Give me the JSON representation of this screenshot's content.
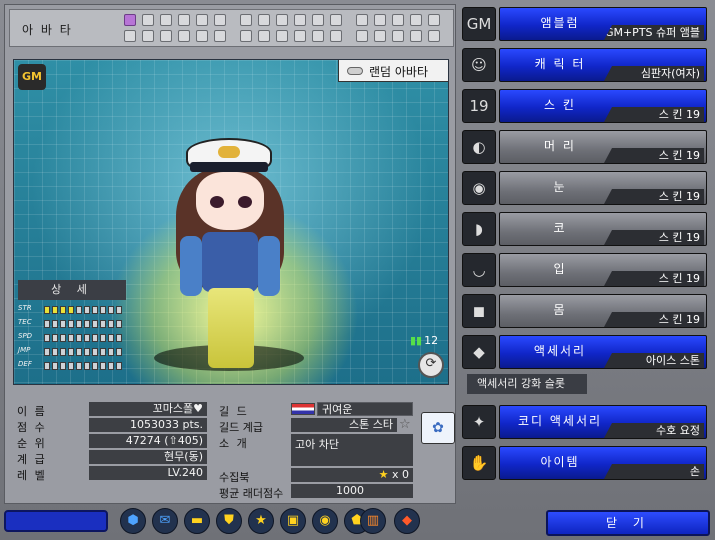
{
  "avatar_header": {
    "title": "아 바 타"
  },
  "viewer": {
    "logo": "GM",
    "random_button": "랜덤 아바타",
    "signal_value": "12",
    "detail_title": "상 세",
    "stats": [
      {
        "name": "STR",
        "level": 4
      },
      {
        "name": "TEC",
        "level": 0
      },
      {
        "name": "SPD",
        "level": 0
      },
      {
        "name": "JMP",
        "level": 0
      },
      {
        "name": "DEF",
        "level": 0
      }
    ]
  },
  "info": {
    "name_label": "이 름",
    "name_value": "꼬마스폴♥",
    "score_label": "점 수",
    "score_value": "1053033 pts.",
    "rank_label": "순 위",
    "rank_value": "47274 (⇧405)",
    "grade_label": "계 급",
    "grade_value": "현무(동)",
    "level_label": "레 벨",
    "level_value": "LV.240",
    "guild_label": "길 드",
    "guild_value": "귀여운",
    "guild_grade_label": "길드 계급",
    "guild_grade_value": "스톤 스타",
    "intro_label": "소 개",
    "intro_value": "고아 차단",
    "collection_label": "수집북",
    "collection_value": "x 0",
    "ladder_label": "평균 래더점수",
    "ladder_value": "1000"
  },
  "right_menu": [
    {
      "label": "앰블럼",
      "value": "GM+PTS 슈퍼 앰블럼",
      "style": "blue",
      "icon": "gm-emblem-icon",
      "glyph": "GM"
    },
    {
      "label": "캐 릭 터",
      "value": "심판자(여자)",
      "style": "blue",
      "icon": "character-icon",
      "glyph": "☺"
    },
    {
      "label": "스    킨",
      "value": "스    킨 19",
      "style": "blue",
      "icon": "skin-icon",
      "glyph": "19"
    },
    {
      "label": "머    리",
      "value": "스    킨 19",
      "style": "grey",
      "icon": "hair-icon",
      "glyph": "◐"
    },
    {
      "label": "눈",
      "value": "스    킨 19",
      "style": "grey",
      "icon": "eyes-icon",
      "glyph": "◉"
    },
    {
      "label": "코",
      "value": "스    킨 19",
      "style": "grey",
      "icon": "nose-icon",
      "glyph": "◗"
    },
    {
      "label": "입",
      "value": "스    킨 19",
      "style": "grey",
      "icon": "mouth-icon",
      "glyph": "◡"
    },
    {
      "label": "몸",
      "value": "스    킨 19",
      "style": "grey",
      "icon": "body-icon",
      "glyph": "◼"
    },
    {
      "label": "액세서리",
      "value": "아이스 스톤",
      "style": "blue",
      "icon": "accessory-icon",
      "glyph": "◆"
    },
    {
      "label": "코디 액세서리",
      "value": "수호 요정",
      "style": "blue",
      "icon": "codi-accessory-icon",
      "glyph": "✦"
    },
    {
      "label": "아이템",
      "value": "손",
      "style": "blue",
      "icon": "hand-icon",
      "glyph": "✋"
    }
  ],
  "accessory_sub_label": "액세서리 강화 슬롯",
  "close_button": "닫 기",
  "colors": {
    "accent_blue": "#1026c8",
    "panel_dark": "#3d3f44",
    "slot_active": "#b774d6"
  }
}
